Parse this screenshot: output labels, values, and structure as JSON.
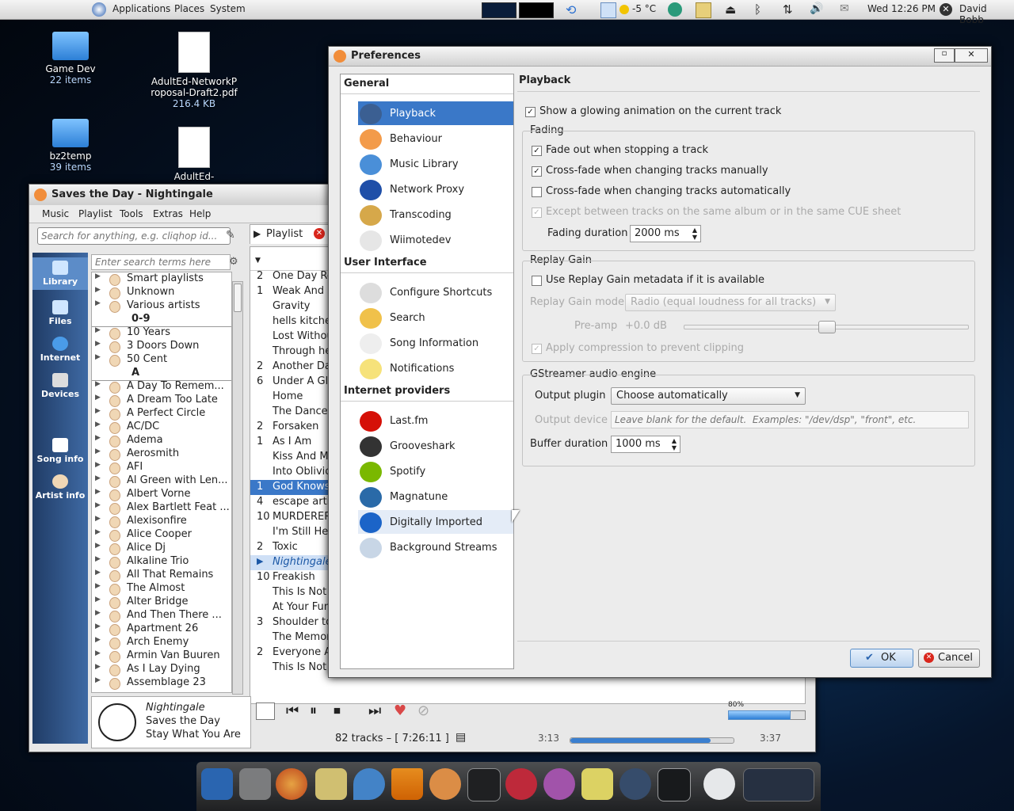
{
  "top_panel": {
    "menus": [
      "Applications",
      "Places",
      "System"
    ],
    "weather": "-5 °C",
    "clock": "Wed 12:26 PM",
    "user": "David Bobb"
  },
  "desktop": {
    "icons": [
      {
        "name": "Game Dev",
        "sub": "22 items"
      },
      {
        "name": "AdultEd-NetworkProposal-Draft2.pdf",
        "sub": "216.4 KB"
      },
      {
        "name": "bz2temp",
        "sub": "39 items"
      },
      {
        "name": "AdultEd-NetworkProposal.odt",
        "sub": ""
      }
    ]
  },
  "player": {
    "title": "Saves the Day - Nightingale",
    "menu": [
      "Music",
      "Playlist",
      "Tools",
      "Extras",
      "Help"
    ],
    "search_placeholder": "Search for anything, e.g. cliqhop id...",
    "filter_placeholder": "Enter search terms here",
    "side_tabs": [
      "Library",
      "Files",
      "Internet",
      "Devices",
      "Song info",
      "Artist info"
    ],
    "playlist_tab": "Playlist",
    "library": [
      {
        "label": "Smart playlists",
        "type": "item"
      },
      {
        "label": "Unknown",
        "type": "item"
      },
      {
        "label": "Various artists",
        "type": "item"
      },
      {
        "label": "0-9",
        "type": "header"
      },
      {
        "label": "10 Years",
        "type": "item"
      },
      {
        "label": "3 Doors Down",
        "type": "item"
      },
      {
        "label": "50 Cent",
        "type": "item"
      },
      {
        "label": "A",
        "type": "header"
      },
      {
        "label": "A Day To Remem...",
        "type": "item"
      },
      {
        "label": "A Dream Too Late",
        "type": "item"
      },
      {
        "label": "A Perfect Circle",
        "type": "item"
      },
      {
        "label": "AC/DC",
        "type": "item"
      },
      {
        "label": "Adema",
        "type": "item"
      },
      {
        "label": "Aerosmith",
        "type": "item"
      },
      {
        "label": "AFI",
        "type": "item"
      },
      {
        "label": "Al Green with Len...",
        "type": "item"
      },
      {
        "label": "Albert Vorne",
        "type": "item"
      },
      {
        "label": "Alex Bartlett Feat ...",
        "type": "item"
      },
      {
        "label": "Alexisonfire",
        "type": "item"
      },
      {
        "label": "Alice Cooper",
        "type": "item"
      },
      {
        "label": "Alice Dj",
        "type": "item"
      },
      {
        "label": "Alkaline Trio",
        "type": "item"
      },
      {
        "label": "All That Remains",
        "type": "item"
      },
      {
        "label": "The Almost",
        "type": "item"
      },
      {
        "label": "Alter Bridge",
        "type": "item"
      },
      {
        "label": "And Then There ...",
        "type": "item"
      },
      {
        "label": "Apartment 26",
        "type": "item"
      },
      {
        "label": "Arch Enemy",
        "type": "item"
      },
      {
        "label": "Armin Van Buuren",
        "type": "item"
      },
      {
        "label": "As I Lay Dying",
        "type": "item"
      },
      {
        "label": "Assemblage 23",
        "type": "item"
      }
    ],
    "tracks": [
      {
        "n": "2",
        "t": "One Day Re",
        "s": ""
      },
      {
        "n": "1",
        "t": "Weak And P",
        "s": ""
      },
      {
        "n": "",
        "t": "Gravity",
        "s": ""
      },
      {
        "n": "",
        "t": "hells kitche",
        "s": ""
      },
      {
        "n": "",
        "t": "Lost Withou",
        "s": ""
      },
      {
        "n": "",
        "t": "Through he",
        "s": ""
      },
      {
        "n": "2",
        "t": "Another Day",
        "s": ""
      },
      {
        "n": "6",
        "t": "Under A Gla",
        "s": ""
      },
      {
        "n": "",
        "t": "Home",
        "s": ""
      },
      {
        "n": "",
        "t": "The Dance",
        "s": ""
      },
      {
        "n": "2",
        "t": "Forsaken",
        "s": ""
      },
      {
        "n": "1",
        "t": "As I Am",
        "s": ""
      },
      {
        "n": "",
        "t": "Kiss And Ma",
        "s": ""
      },
      {
        "n": "",
        "t": "Into Oblivio",
        "s": ""
      },
      {
        "n": "1",
        "t": "God Knows",
        "s": "sel"
      },
      {
        "n": "4",
        "t": "escape artis",
        "s": ""
      },
      {
        "n": "10",
        "t": "MURDERERS",
        "s": ""
      },
      {
        "n": "",
        "t": "I'm Still He",
        "s": ""
      },
      {
        "n": "2",
        "t": "Toxic",
        "s": ""
      },
      {
        "n": "",
        "t": "Nightingale",
        "s": "play"
      },
      {
        "n": "10",
        "t": "Freakish",
        "s": ""
      },
      {
        "n": "",
        "t": "This Is Not",
        "s": ""
      },
      {
        "n": "",
        "t": "At Your Fun",
        "s": ""
      },
      {
        "n": "3",
        "t": "Shoulder to",
        "s": ""
      },
      {
        "n": "",
        "t": "The Memory",
        "s": ""
      },
      {
        "n": "2",
        "t": "Everyone A",
        "s": ""
      }
    ],
    "last_row": {
      "title": "This Is Not An Exit",
      "artist": "Saves the Day",
      "album": "Stay What You Are",
      "len": "3:..."
    },
    "now_playing": {
      "title": "Nightingale",
      "artist": "Saves the Day",
      "album": "Stay What You Are"
    },
    "status": {
      "tracks": "82 tracks – [ 7:26:11 ]",
      "elapsed": "3:13",
      "total": "3:37",
      "volume": "80%"
    },
    "progress_fraction": 0.86
  },
  "prefs": {
    "title": "Preferences",
    "groups": [
      {
        "label": "General",
        "items": [
          "Playback",
          "Behaviour",
          "Music Library",
          "Network Proxy",
          "Transcoding",
          "Wiimotedev"
        ]
      },
      {
        "label": "User Interface",
        "items": [
          "Configure Shortcuts",
          "Search",
          "Song Information",
          "Notifications"
        ]
      },
      {
        "label": "Internet providers",
        "items": [
          "Last.fm",
          "Grooveshark",
          "Spotify",
          "Magnatune",
          "Digitally Imported",
          "Background Streams"
        ]
      }
    ],
    "page_title": "Playback",
    "glow": "Show a glowing animation on the current track",
    "fading": {
      "title": "Fading",
      "fade_out": "Fade out when stopping a track",
      "cross_manual": "Cross-fade when changing tracks manually",
      "cross_auto": "Cross-fade when changing tracks automatically",
      "except": "Except between tracks on the same album or in the same CUE sheet",
      "duration_label": "Fading duration",
      "duration_value": "2000 ms"
    },
    "replay": {
      "title": "Replay Gain",
      "use": "Use Replay Gain metadata if it is available",
      "mode_label": "Replay Gain mode",
      "mode_value": "Radio (equal loudness for all tracks)",
      "preamp_label": "Pre-amp",
      "preamp_value": "+0.0 dB",
      "preamp_fraction": 0.5,
      "compress": "Apply compression to prevent clipping"
    },
    "gst": {
      "title": "GStreamer audio engine",
      "plugin_label": "Output plugin",
      "plugin_value": "Choose automatically",
      "device_label": "Output device",
      "device_placeholder": "Leave blank for the default.  Examples: \"/dev/dsp\", \"front\", etc.",
      "buffer_label": "Buffer duration",
      "buffer_value": "1000 ms"
    },
    "ok": "OK",
    "cancel": "Cancel"
  }
}
